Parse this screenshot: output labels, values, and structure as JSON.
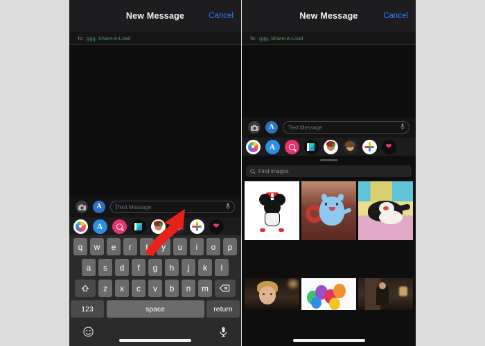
{
  "meta": {
    "background_color": "#dcdcdc",
    "accent_blue": "#2f7cf6",
    "recipient_green": "#4f9b5e",
    "annotation_color": "#e8211b"
  },
  "panels": [
    {
      "id": "left",
      "navbar": {
        "title": "New Message",
        "cancel_label": "Cancel"
      },
      "to_field": {
        "label": "To:",
        "value": "ggg, Share-A-Load"
      },
      "compose": {
        "camera_icon": "camera-icon",
        "apps_icon": "app-store-icon",
        "placeholder": "Text Message",
        "mic_icon": "microphone-icon"
      },
      "app_drawer": [
        {
          "name": "photos-app-icon",
          "label": "Photos"
        },
        {
          "name": "app-store-app-icon",
          "label": "App Store"
        },
        {
          "name": "images-app-icon",
          "label": "#images"
        },
        {
          "name": "document-app-icon",
          "label": "Files"
        },
        {
          "name": "memoji-sticker-icon",
          "label": "Memoji"
        },
        {
          "name": "memoji-avatar-icon",
          "label": "Memoji 2"
        },
        {
          "name": "google-photos-app-icon",
          "label": "Google Photos"
        },
        {
          "name": "heart-sticker-icon",
          "label": "Stickers"
        }
      ],
      "keyboard": {
        "row1": [
          "q",
          "w",
          "e",
          "r",
          "t",
          "y",
          "u",
          "i",
          "o",
          "p"
        ],
        "row2": [
          "a",
          "s",
          "d",
          "f",
          "g",
          "h",
          "j",
          "k",
          "l"
        ],
        "row3": [
          "z",
          "x",
          "c",
          "v",
          "b",
          "n",
          "m"
        ],
        "shift_icon": "shift-icon",
        "backspace_icon": "backspace-icon",
        "numbers_label": "123",
        "space_label": "space",
        "return_label": "return",
        "emoji_icon": "emoji-icon",
        "dictate_icon": "microphone-icon"
      },
      "annotation": {
        "type": "arrow",
        "points_to": "app-store-app-icon"
      }
    },
    {
      "id": "right",
      "navbar": {
        "title": "New Message",
        "cancel_label": "Cancel"
      },
      "to_field": {
        "label": "To:",
        "value": "ggg, Share-A-Load"
      },
      "compose": {
        "camera_icon": "camera-icon",
        "apps_icon": "app-store-icon",
        "placeholder": "Text Message",
        "mic_icon": "microphone-icon"
      },
      "app_drawer": [
        {
          "name": "photos-app-icon",
          "label": "Photos"
        },
        {
          "name": "app-store-app-icon",
          "label": "App Store"
        },
        {
          "name": "images-app-icon",
          "label": "#images"
        },
        {
          "name": "document-app-icon",
          "label": "Files"
        },
        {
          "name": "memoji-sticker-icon",
          "label": "Memoji"
        },
        {
          "name": "memoji-avatar-icon",
          "label": "Memoji 2"
        },
        {
          "name": "google-photos-app-icon",
          "label": "Google Photos"
        },
        {
          "name": "heart-sticker-icon",
          "label": "Stickers"
        }
      ],
      "images_app": {
        "search_placeholder": "Find images",
        "search_icon": "magnifier-icon",
        "results": [
          {
            "name": "minnie-mouse-thumbnail",
            "row": 1
          },
          {
            "name": "catbug-thumbnail",
            "row": 1
          },
          {
            "name": "sylvester-cat-thumbnail",
            "row": 1
          },
          {
            "name": "blond-man-thumbnail",
            "row": 2
          },
          {
            "name": "balloons-thumbnail",
            "row": 2
          },
          {
            "name": "man-in-room-thumbnail",
            "row": 2
          }
        ]
      }
    }
  ]
}
